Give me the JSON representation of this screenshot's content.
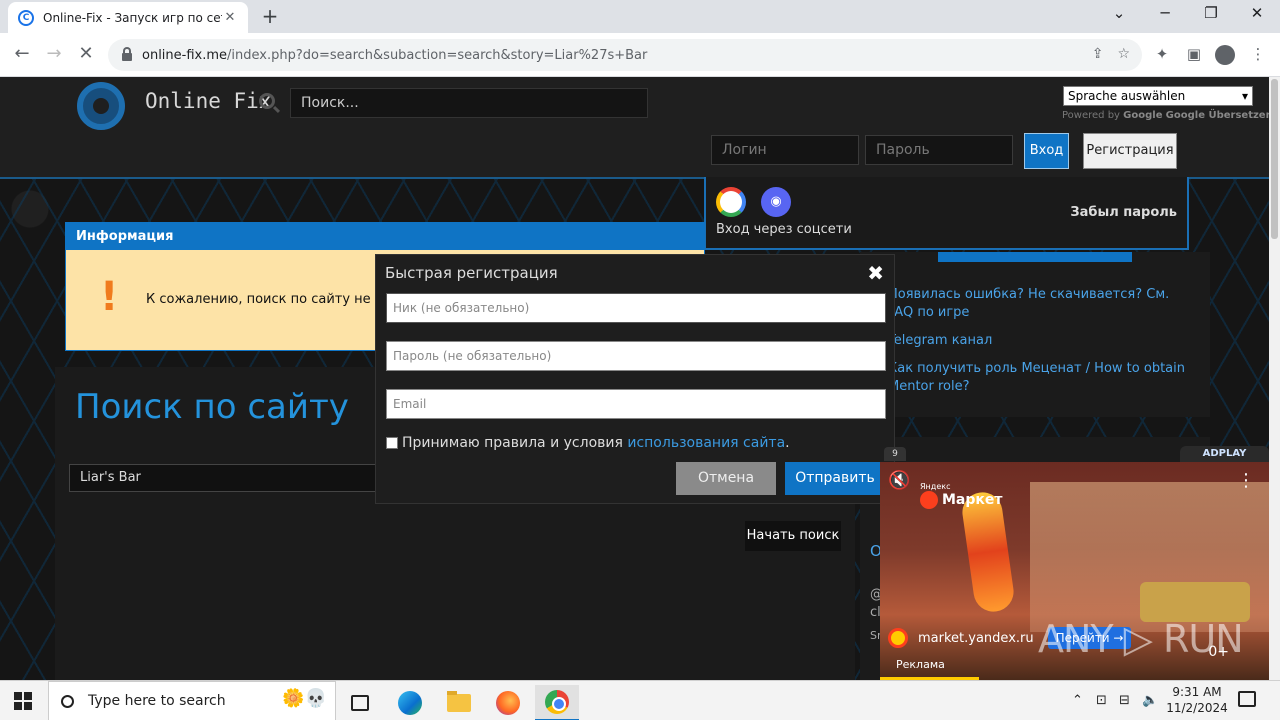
{
  "browser": {
    "tab_title": "Online-Fix - Запуск игр по сети",
    "tab_close": "✕",
    "new_tab": "+",
    "win_min": "⌄",
    "win_minimize": "─",
    "win_restore": "❐",
    "win_close": "✕",
    "url_host": "online-fix.me",
    "url_path": "/index.php?do=search&subaction=search&story=Liar%27s+Bar",
    "back": "←",
    "forward": "→",
    "reload": "✕"
  },
  "header": {
    "site_name": "Online Fix",
    "search_placeholder": "Поиск...",
    "lang_select": "Sprache auswählen",
    "powered_by": "Powered by",
    "powered_google": "Google",
    "powered_translate": "Google Übersetzer",
    "login_placeholder": "Логин",
    "password_placeholder": "Пароль",
    "login_button": "Вход",
    "register_button": "Регистрация"
  },
  "social": {
    "label": "Вход через соцсети",
    "forgot_password": "Забыл пароль"
  },
  "info": {
    "heading": "Информация",
    "icon": "!",
    "message": "К сожалению, поиск по сайту не дал"
  },
  "search": {
    "title": "Поиск по сайту",
    "query": "Liar's Bar",
    "start_button": "Начать поиск"
  },
  "sidebar": {
    "links": [
      "Появилась ошибка? Не скачивается? См. FAQ по игре",
      "Telegram канал",
      "Как получить роль Меценат / How to obtain Mentor role?"
    ],
    "extra_1": "О",
    "extra_2": "@",
    "extra_3": "cl",
    "extra_4": "Sr"
  },
  "modal": {
    "title": "Быстрая регистрация",
    "close": "✖",
    "nick_placeholder": "Ник (не обязательно)",
    "password_placeholder": "Пароль (не обязательно)",
    "email_placeholder": "Email",
    "accept_text": "Принимаю правила и условия",
    "terms_link": "использования сайта",
    "terms_dot": ".",
    "cancel_button": "Отмена",
    "submit_button": "Отправить"
  },
  "ad": {
    "counter": "9",
    "adplay_label": "ADPLAY",
    "brand_top": "Яндекс",
    "brand": "Маркет",
    "domain": "market.yandex.ru",
    "go_button": "Перейти →",
    "label": "Реклама",
    "age": "0+",
    "mute_icon": "🔇",
    "more_icon": "⋮"
  },
  "watermark": "ANY ▷ RUN",
  "taskbar": {
    "search_text": "Type here to search",
    "time": "9:31 AM",
    "date": "11/2/2024"
  }
}
